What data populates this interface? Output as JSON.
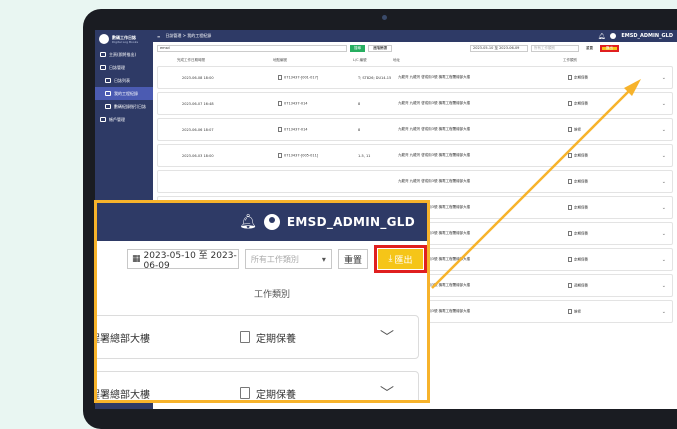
{
  "app": {
    "title": "數碼工作日誌",
    "subtitle": "Digital Log Books"
  },
  "sidebar": {
    "items": [
      {
        "label": "主頁(即將推出)"
      },
      {
        "label": "日誌管理"
      },
      {
        "label": "日誌列表"
      },
      {
        "label": "我的工程紀錄"
      },
      {
        "label": "數碼紀錄指引日誌"
      },
      {
        "label": "帳戶管理"
      }
    ]
  },
  "topbar": {
    "breadcrumb": "日誌管理 > 我的工程紀錄",
    "username": "EMSD_ADMIN_GLD"
  },
  "filters": {
    "search_value": "emsd",
    "search_button": "搜尋",
    "advanced_button": "進階篩選",
    "date_range": "2023-05-10 至 2023-06-09",
    "type_placeholder": "所有工作類別",
    "reset_button": "重置",
    "export_button": "匯出"
  },
  "table": {
    "headers": [
      "完成工作日期時間",
      "地點編號",
      "L/C 編號",
      "地址",
      "工作類別"
    ],
    "rows": [
      {
        "datetime": "2023-06-08 18:00",
        "ref": "0713437-[001-017]",
        "lc": "T; ST826; DU14-15",
        "address": "九龍灣 九龍灣 啓成街3號 機電工程署總部大樓",
        "type": "定期保養"
      },
      {
        "datetime": "2023-06-07 16:48",
        "ref": "0713437-014",
        "lc": "8",
        "address": "九龍灣 九龍灣 啓成街3號 機電工程署總部大樓",
        "type": "定期保養"
      },
      {
        "datetime": "2023-06-06 18:07",
        "ref": "0713437-014",
        "lc": "8",
        "address": "九龍灣 九龍灣 啓成街3號 機電工程署總部大樓",
        "type": "維修"
      },
      {
        "datetime": "2023-06-03 18:00",
        "ref": "0713437-[005-011]",
        "lc": "1-5, 11",
        "address": "九龍灣 九龍灣 啓成街3號 機電工程署總部大樓",
        "type": "定期保養"
      },
      {
        "datetime": "",
        "ref": "",
        "lc": "",
        "address": "九龍灣 九龍灣 啓成街3號 機電工程署總部大樓",
        "type": "定期保養"
      },
      {
        "datetime": "",
        "ref": "",
        "lc": "",
        "address": "九龍灣 九龍灣 啓成街3號 機電工程署總部大樓",
        "type": "定期保養"
      },
      {
        "datetime": "",
        "ref": "",
        "lc": "",
        "address": "九龍灣 九龍灣 啓成街3號 機電工程署總部大樓",
        "type": "定期保養"
      },
      {
        "datetime": "",
        "ref": "",
        "lc": "",
        "address": "九龍灣 九龍灣 啓成街3號 機電工程署總部大樓",
        "type": "定期保養"
      },
      {
        "datetime": "",
        "ref": "",
        "lc": "",
        "address": "九龍灣 九龍灣 啓成街3號 機電工程署總部大樓",
        "type": "週期保養"
      },
      {
        "datetime": "",
        "ref": "",
        "lc": "",
        "address": "九龍灣 九龍灣 啓成街3號 機電工程署總部大樓",
        "type": "維修"
      }
    ]
  },
  "zoom": {
    "username": "EMSD_ADMIN_GLD",
    "date_range": "2023-05-10 至 2023-06-09",
    "type_placeholder": "所有工作類別",
    "reset_button": "重置",
    "export_button": "匯出",
    "column_header": "工作類別",
    "cards": [
      {
        "location": "程署總部大樓",
        "type": "定期保養"
      },
      {
        "location": "程署總部大樓",
        "type": "定期保養"
      }
    ]
  },
  "colors": {
    "navy": "#2e3a66",
    "export_yellow": "#f5c518",
    "highlight_red": "#e01f1f",
    "callout_orange": "#f7b32b",
    "search_green": "#27ae60"
  }
}
